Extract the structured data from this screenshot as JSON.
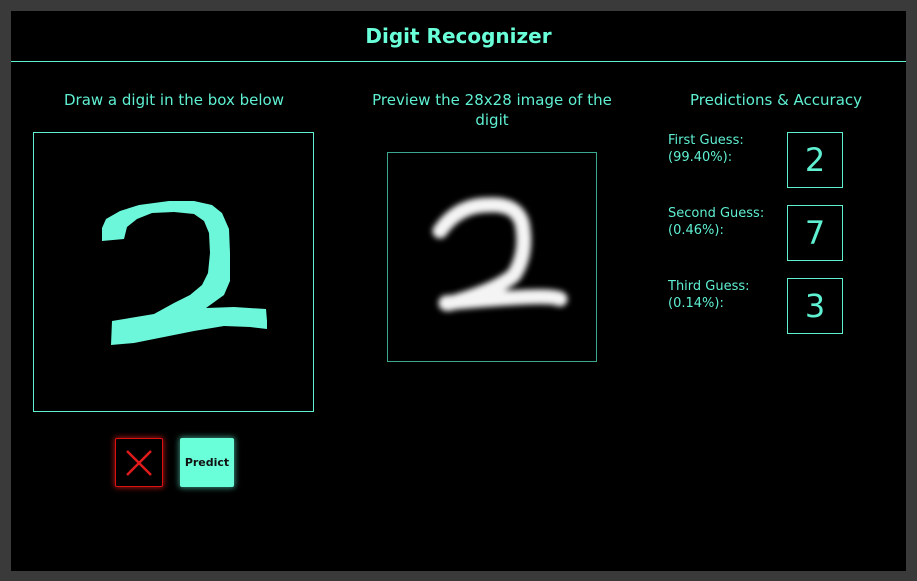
{
  "app": {
    "title": "Digit Recognizer"
  },
  "draw_panel": {
    "title": "Draw a digit in the box below",
    "clear_icon": "close-x-icon",
    "predict_label": "Predict"
  },
  "preview_panel": {
    "title": "Preview the 28x28 image of the digit"
  },
  "predictions": {
    "title": "Predictions & Accuracy",
    "guesses": [
      {
        "label": "First Guess:",
        "confidence": "(99.40%):",
        "digit": "2"
      },
      {
        "label": "Second Guess:",
        "confidence": "(0.46%):",
        "digit": "7"
      },
      {
        "label": "Third Guess:",
        "confidence": "(0.14%):",
        "digit": "3"
      }
    ]
  },
  "colors": {
    "accent": "#5ff0d2",
    "ink": "#68ffd9",
    "danger": "#dd1111",
    "background": "#000000",
    "frame": "#3a3a3a"
  }
}
